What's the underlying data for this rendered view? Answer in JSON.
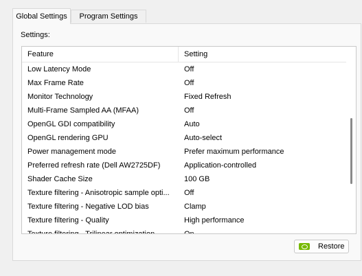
{
  "tabs": [
    {
      "label": "Global Settings",
      "active": true
    },
    {
      "label": "Program Settings",
      "active": false
    }
  ],
  "settings_label": "Settings:",
  "table": {
    "columns": [
      "Feature",
      "Setting"
    ],
    "rows": [
      {
        "feature": "Low Latency Mode",
        "setting": "Off"
      },
      {
        "feature": "Max Frame Rate",
        "setting": "Off"
      },
      {
        "feature": "Monitor Technology",
        "setting": "Fixed Refresh"
      },
      {
        "feature": "Multi-Frame Sampled AA (MFAA)",
        "setting": "Off"
      },
      {
        "feature": "OpenGL GDI compatibility",
        "setting": "Auto"
      },
      {
        "feature": "OpenGL rendering GPU",
        "setting": "Auto-select"
      },
      {
        "feature": "Power management mode",
        "setting": "Prefer maximum performance"
      },
      {
        "feature": "Preferred refresh rate (Dell AW2725DF)",
        "setting": "Application-controlled"
      },
      {
        "feature": "Shader Cache Size",
        "setting": "100 GB"
      },
      {
        "feature": "Texture filtering - Anisotropic sample opti...",
        "setting": "Off"
      },
      {
        "feature": "Texture filtering - Negative LOD bias",
        "setting": "Clamp"
      },
      {
        "feature": "Texture filtering - Quality",
        "setting": "High performance"
      },
      {
        "feature": "Texture filtering - Trilinear optimization",
        "setting": "On"
      }
    ]
  },
  "restore_label": "Restore",
  "icons": {
    "restore": "nvidia-logo-icon"
  },
  "colors": {
    "accent": "#76b900"
  }
}
